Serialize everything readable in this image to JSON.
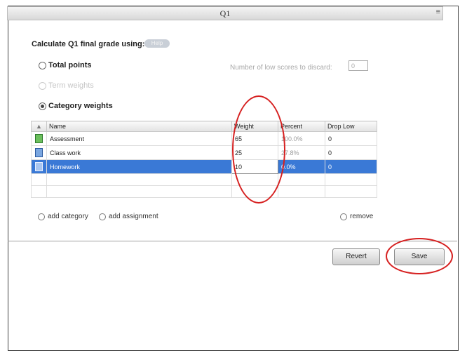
{
  "window": {
    "title": "Q1",
    "grip": "≡"
  },
  "settings": {
    "calculate_label": "Calculate Q1 final grade using:",
    "pill_label": "Help",
    "options": {
      "total_points": "Total points",
      "term_weights": "Term weights",
      "category_weights": "Category weights"
    },
    "selected_option": "category_weights",
    "low_scores_label": "Number of low scores to discard:",
    "low_scores_value": "0"
  },
  "table": {
    "sort_arrow": "▲",
    "columns": [
      "Name",
      "Weight",
      "Percent",
      "Drop Low"
    ],
    "rows": [
      {
        "name": "Assessment",
        "weight": "65",
        "percent": "100.0%",
        "drop_low": "0",
        "icon": "green-sheet-icon"
      },
      {
        "name": "Class work",
        "weight": "25",
        "percent": "27.8%",
        "drop_low": "0",
        "icon": "blue-sheet-icon"
      },
      {
        "name": "Homework",
        "weight": "10",
        "percent": "0.0%",
        "drop_low": "0",
        "icon": "blue-sheet-icon",
        "selected": true
      }
    ]
  },
  "actions": {
    "add_category": "add category",
    "add_assignment": "add assignment",
    "remove": "remove"
  },
  "buttons": {
    "revert": "Revert",
    "save": "Save"
  },
  "colors": {
    "selection": "#3a79d6",
    "highlight_circle": "#d62020"
  }
}
